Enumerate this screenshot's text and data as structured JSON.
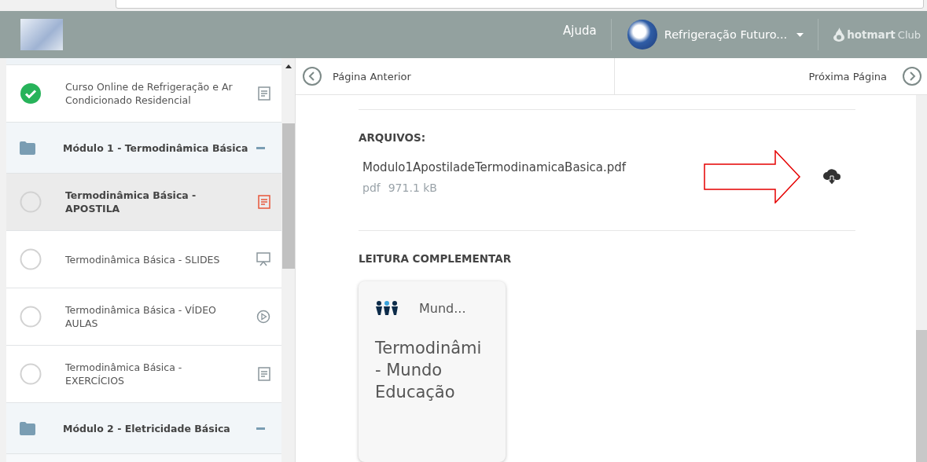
{
  "header": {
    "help": "Ajuda",
    "user_name": "Refrigeração Futuro...",
    "brand": "hotmart",
    "brand_suffix": "Club"
  },
  "sidebar": {
    "items": [
      {
        "kind": "document",
        "title": "Curso Online de Refrigeração e Ar Condicionado Residencial",
        "completed": true,
        "selected": false
      },
      {
        "kind": "module",
        "title": "Módulo 1 - Termodinâmica Básica",
        "expanded": true
      },
      {
        "kind": "document",
        "title": "Termodinâmica Básica - APOSTILA",
        "completed": false,
        "selected": true
      },
      {
        "kind": "slides",
        "title": "Termodinâmica Básica - SLIDES",
        "completed": false,
        "selected": false
      },
      {
        "kind": "video",
        "title": "Termodinâmica Básica - VÍDEO AULAS",
        "completed": false,
        "selected": false
      },
      {
        "kind": "document",
        "title": "Termodinâmica Básica - EXERCÍCIOS",
        "completed": false,
        "selected": false
      },
      {
        "kind": "module",
        "title": "Módulo 2 - Eletricidade Básica",
        "expanded": true
      }
    ]
  },
  "pager": {
    "previous": "Página Anterior",
    "next": "Próxima Página"
  },
  "files": {
    "heading": "ARQUIVOS:",
    "items": [
      {
        "name": "Modulo1ApostiladeTermodinamicaBasica.pdf",
        "type": "pdf",
        "size": "971.1 kB"
      }
    ]
  },
  "reading": {
    "heading": "LEITURA COMPLEMENTAR",
    "cards": [
      {
        "source": "Mund...",
        "title_lines": [
          "Termodinâmi",
          "- Mundo",
          "Educação"
        ]
      }
    ]
  }
}
